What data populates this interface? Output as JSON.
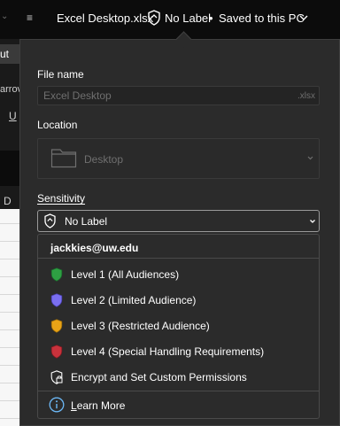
{
  "titlebar": {
    "qa_dropdown_glyph": "⌄",
    "qa_menu_glyph": "≡",
    "document_title": "Excel Desktop.xlsx",
    "sensitivity_label": "No Label",
    "separator": "•",
    "save_status": "Saved to this PC"
  },
  "background": {
    "ribbon_tab_fragment": "ut",
    "ribbon_text_fragment": "arrov",
    "underline_button": "U",
    "column_header": "D"
  },
  "panel": {
    "file_name_label": "File name",
    "file_name_value": "Excel Desktop",
    "file_extension": ".xlsx",
    "location_label": "Location",
    "location_value": "Desktop",
    "sensitivity_label": "Sensitivity",
    "sensitivity_selected": "No Label"
  },
  "sensitivity_menu": {
    "account": "jackkies@uw.edu",
    "items": [
      {
        "label": "Level 1 (All Audiences)",
        "icon": "green-shield-icon",
        "color": "#2ea043"
      },
      {
        "label": "Level 2 (Limited Audience)",
        "icon": "purple-shield-icon",
        "color": "#7a6ff0"
      },
      {
        "label": "Level 3 (Restricted Audience)",
        "icon": "yellow-shield-icon",
        "color": "#e8a317"
      },
      {
        "label": "Level 4 (Special Handling Requirements)",
        "icon": "red-shield-icon",
        "color": "#c8323c"
      }
    ],
    "custom_permissions": "Encrypt and Set Custom Permissions",
    "learn_more_first": "L",
    "learn_more_rest": "earn More"
  }
}
